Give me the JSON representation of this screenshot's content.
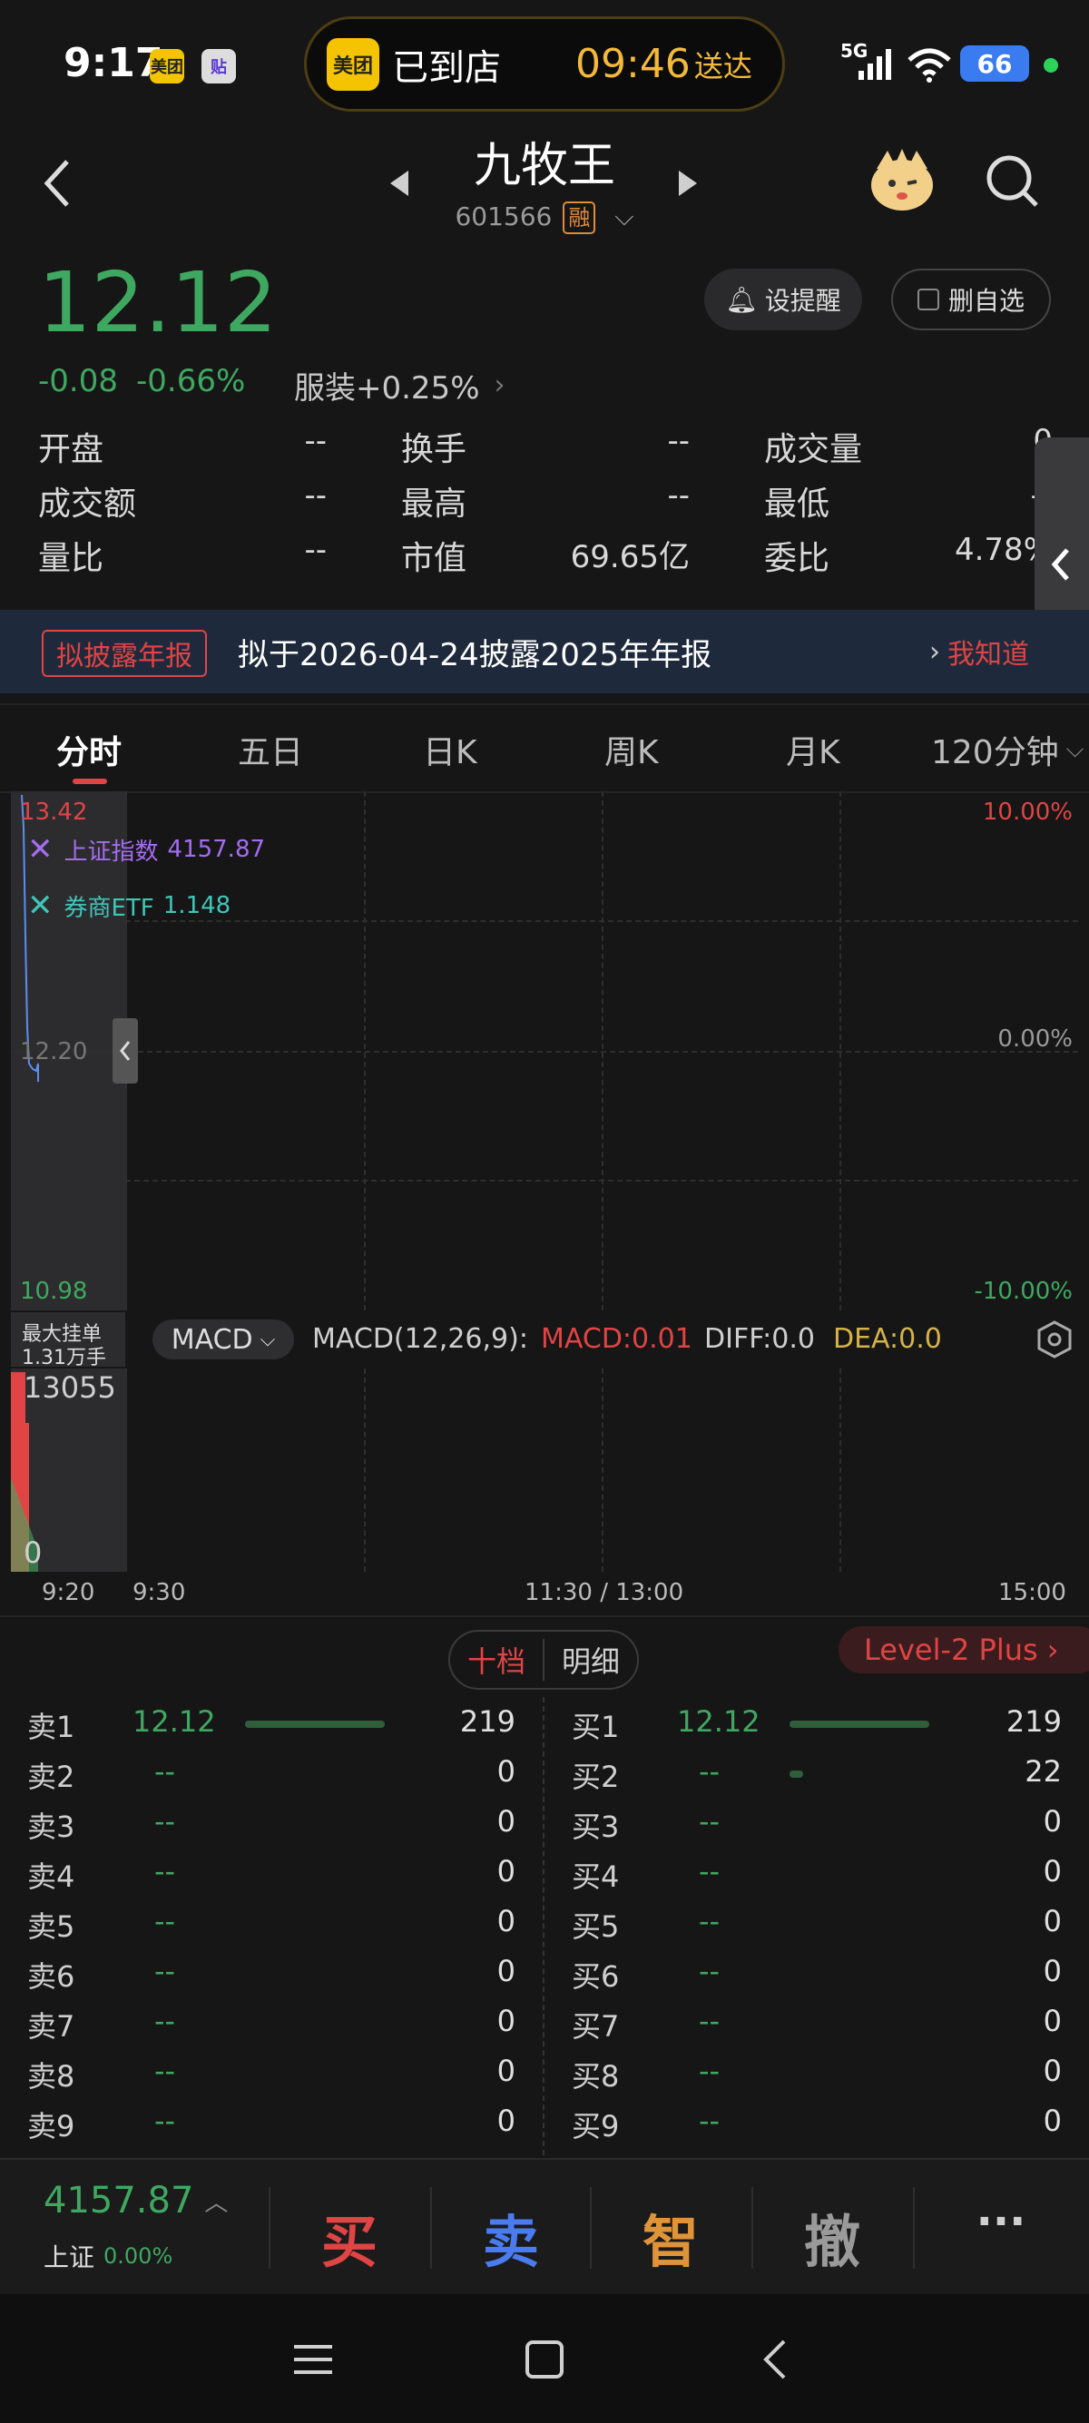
{
  "status_bar": {
    "time": "9:17",
    "app1": "美团",
    "app2": "贴",
    "island_app": "美团",
    "island_status": "已到店",
    "island_time": "09:46",
    "island_suffix": "送达",
    "network": "5G",
    "battery": "66"
  },
  "header": {
    "title": "九牧王",
    "code": "601566",
    "margin_tag": "融"
  },
  "quote": {
    "price": "12.12",
    "change": "-0.08",
    "change_pct": "-0.66%",
    "sector": "服装+0.25%",
    "alert_label": "设提醒",
    "watchlist_label": "删自选",
    "stats": [
      {
        "label": "开盘",
        "value": "--"
      },
      {
        "label": "换手",
        "value": "--"
      },
      {
        "label": "成交量",
        "value": "0"
      },
      {
        "label": "成交额",
        "value": "--"
      },
      {
        "label": "最高",
        "value": "--"
      },
      {
        "label": "最低",
        "value": "--"
      },
      {
        "label": "量比",
        "value": "--"
      },
      {
        "label": "市值",
        "value": "69.65亿"
      },
      {
        "label": "委比",
        "value": "4.78%"
      }
    ]
  },
  "banner": {
    "tag": "拟披露年报",
    "text": "拟于2026-04-24披露2025年年报",
    "action": "我知道"
  },
  "tabs": [
    "分时",
    "五日",
    "日K",
    "周K",
    "月K",
    "120分钟"
  ],
  "chart": {
    "y_high": "13.42",
    "y_mid": "12.20",
    "y_low": "10.98",
    "pct_high": "10.00%",
    "pct_mid": "0.00%",
    "pct_low": "-10.00%",
    "legend1_name": "上证指数",
    "legend1_value": "4157.87",
    "legend2_name": "券商ETF",
    "legend2_value": "1.148",
    "max_order_label": "最大挂单",
    "max_order_value": "1.31万手",
    "indicator": "MACD",
    "indicator_params": "MACD(12,26,9):",
    "macd": "MACD:0.01",
    "diff": "DIFF:0.0",
    "dea": "DEA:0.0",
    "vol_high": "13055",
    "vol_low": "0",
    "times": [
      "9:20",
      "9:30",
      "11:30 / 13:00",
      "15:00"
    ]
  },
  "orderbook": {
    "tab_ten": "十档",
    "tab_detail": "明细",
    "level2": "Level-2 Plus",
    "sell": [
      {
        "label": "卖1",
        "price": "12.12",
        "vol": "219",
        "bar": 1.0
      },
      {
        "label": "卖2",
        "price": "--",
        "vol": "0",
        "bar": 0
      },
      {
        "label": "卖3",
        "price": "--",
        "vol": "0",
        "bar": 0
      },
      {
        "label": "卖4",
        "price": "--",
        "vol": "0",
        "bar": 0
      },
      {
        "label": "卖5",
        "price": "--",
        "vol": "0",
        "bar": 0
      },
      {
        "label": "卖6",
        "price": "--",
        "vol": "0",
        "bar": 0
      },
      {
        "label": "卖7",
        "price": "--",
        "vol": "0",
        "bar": 0
      },
      {
        "label": "卖8",
        "price": "--",
        "vol": "0",
        "bar": 0
      },
      {
        "label": "卖9",
        "price": "--",
        "vol": "0",
        "bar": 0
      }
    ],
    "buy": [
      {
        "label": "买1",
        "price": "12.12",
        "vol": "219",
        "bar": 1.0
      },
      {
        "label": "买2",
        "price": "--",
        "vol": "22",
        "bar": 0.1
      },
      {
        "label": "买3",
        "price": "--",
        "vol": "0",
        "bar": 0
      },
      {
        "label": "买4",
        "price": "--",
        "vol": "0",
        "bar": 0
      },
      {
        "label": "买5",
        "price": "--",
        "vol": "0",
        "bar": 0
      },
      {
        "label": "买6",
        "price": "--",
        "vol": "0",
        "bar": 0
      },
      {
        "label": "买7",
        "price": "--",
        "vol": "0",
        "bar": 0
      },
      {
        "label": "买8",
        "price": "--",
        "vol": "0",
        "bar": 0
      },
      {
        "label": "买9",
        "price": "--",
        "vol": "0",
        "bar": 0
      }
    ]
  },
  "bottom": {
    "index_value": "4157.87",
    "index_name": "上证",
    "index_pct": "0.00%",
    "buy": "买",
    "sell": "卖",
    "smart": "智",
    "cancel": "撤",
    "more": "···"
  },
  "colors": {
    "up": "#e04444",
    "down": "#3fa860",
    "macd_yellow": "#d6b24a",
    "legend_purple": "#a46cf0",
    "legend_teal": "#3fc6b8"
  }
}
